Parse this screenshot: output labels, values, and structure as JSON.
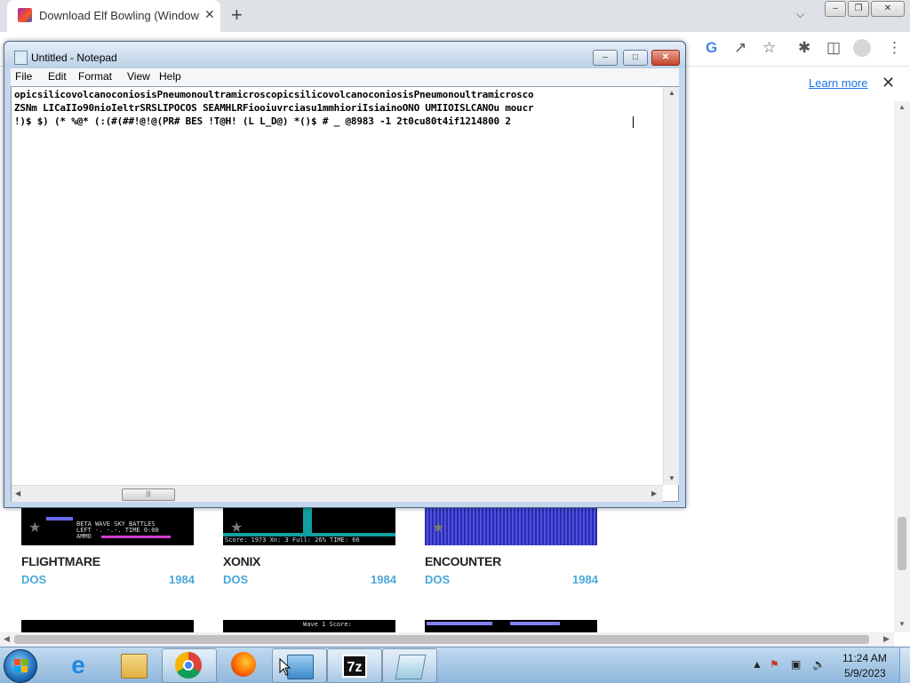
{
  "browser": {
    "tab_title": "Download Elf Bowling (Windows)",
    "tab_close": "✕",
    "new_tab": "+",
    "tab_list": "⌄",
    "infobar_link": "Learn more",
    "infobar_close": "✕",
    "icons": [
      "google-icon",
      "share-icon",
      "star-icon",
      "extensions-icon",
      "side-panel-icon",
      "profile-icon",
      "menu-icon"
    ],
    "window_buttons": [
      "–",
      "❐",
      "✕"
    ]
  },
  "games": [
    {
      "name": "FLIGHTMARE",
      "platform": "DOS",
      "year": "1984",
      "thumb_lines": [
        "BETA WAVE   SKY BATTLES",
        "LEFT  -. -.-. TIME 0:00",
        "AMMO"
      ]
    },
    {
      "name": "XONIX",
      "platform": "DOS",
      "year": "1984",
      "thumb_lines": [
        "Score: 1973  Xn: 3 Full: 26% TIME: 66"
      ]
    },
    {
      "name": "ENCOUNTER",
      "platform": "DOS",
      "year": "1984",
      "thumb_lines": []
    }
  ],
  "games_row2": {
    "thumb_text": "Wave  1   Score:"
  },
  "notepad": {
    "title": "Untitled - Notepad",
    "menu": [
      "File",
      "Edit",
      "Format",
      "View",
      "Help"
    ],
    "lines": [
      "opicsilicovolcanoconiosisPneumonoultramicroscopicsilicovolcanoconiosisPneumonoultramicrosco",
      "ZSNm LICaIIo90nioIeltrSRSLIPOCOS SEAMHLRFiooiuvrciasu1mmhioriIsiainoONO UMIIOISLCANOu moucr",
      "!)$ $) (* %@* (:(#(##!@!@(PR# BES !T@H! (L L_D@) *()$ # _ @8983 -1 2t0cu80t4if1214800 2"
    ],
    "buttons": {
      "minimize": "–",
      "maximize": "□",
      "close": "✕"
    }
  },
  "taskbar": {
    "apps": [
      "ie-icon",
      "file-explorer-icon",
      "chrome-icon",
      "firefox-icon",
      "control-panel-icon",
      "7zip-icon",
      "notepad-icon"
    ],
    "sevenzip_label": "7z",
    "time": "11:24 AM",
    "date": "5/9/2023"
  },
  "colors": {
    "accent_link": "#1a73e8",
    "game_meta": "#4aa8d8",
    "taskbar": "#a8c9e6"
  }
}
